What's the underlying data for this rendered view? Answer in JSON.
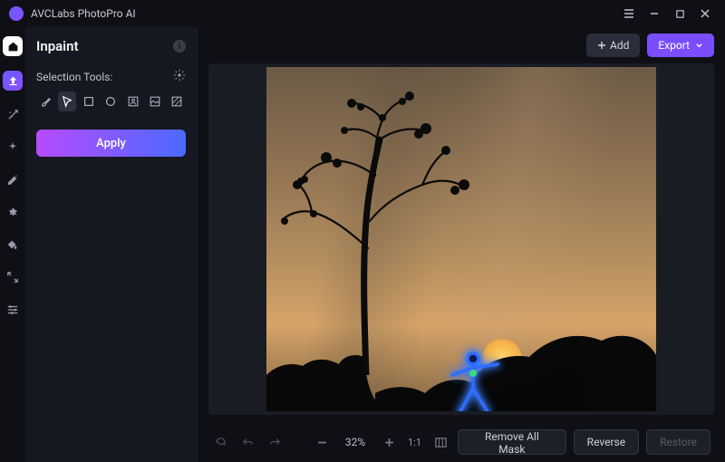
{
  "app": {
    "name": "AVCLabs PhotoPro AI"
  },
  "panel": {
    "title": "Inpaint",
    "section_label": "Selection Tools:",
    "apply_label": "Apply"
  },
  "header": {
    "add_label": "Add",
    "export_label": "Export"
  },
  "footer": {
    "zoom_text": "32%",
    "remove_label": "Remove All Mask",
    "reverse_label": "Reverse",
    "restore_label": "Restore"
  },
  "tools": {
    "icons": [
      "brush",
      "lasso",
      "rectangle",
      "ellipse",
      "subject",
      "bg",
      "threshold"
    ],
    "selected": "lasso"
  },
  "rail": {
    "icons": [
      "home",
      "upload",
      "magic",
      "sparkle",
      "retouch",
      "swap",
      "fill",
      "expand",
      "sliders"
    ]
  }
}
